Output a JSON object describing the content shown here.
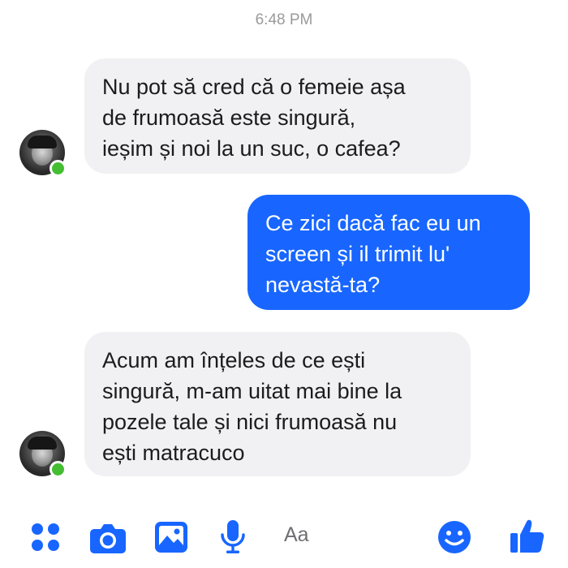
{
  "conversation": {
    "timestamp": "6:48 PM",
    "messages": [
      {
        "direction": "incoming",
        "text": "Nu pot să cred că o femeie așa\nde frumoasă este singură,\nieșim și noi la un suc, o cafea?"
      },
      {
        "direction": "outgoing",
        "text": "Ce zici dacă fac eu un\nscreen și il trimit lu'\nnevastă-ta?"
      },
      {
        "direction": "incoming",
        "text": "Acum am înțeles de ce ești\nsingură, m-am uitat mai bine la\npozele tale și nici frumoasă nu\nești matracuco"
      }
    ]
  },
  "composer": {
    "placeholder": "Aa",
    "icons": [
      "apps-icon",
      "camera-icon",
      "gallery-icon",
      "microphone-icon",
      "emoji-icon",
      "like-thumb-icon"
    ]
  },
  "colors": {
    "accent": "#1866ff",
    "incoming_bubble": "#f1f1f3",
    "online": "#44bd32"
  }
}
